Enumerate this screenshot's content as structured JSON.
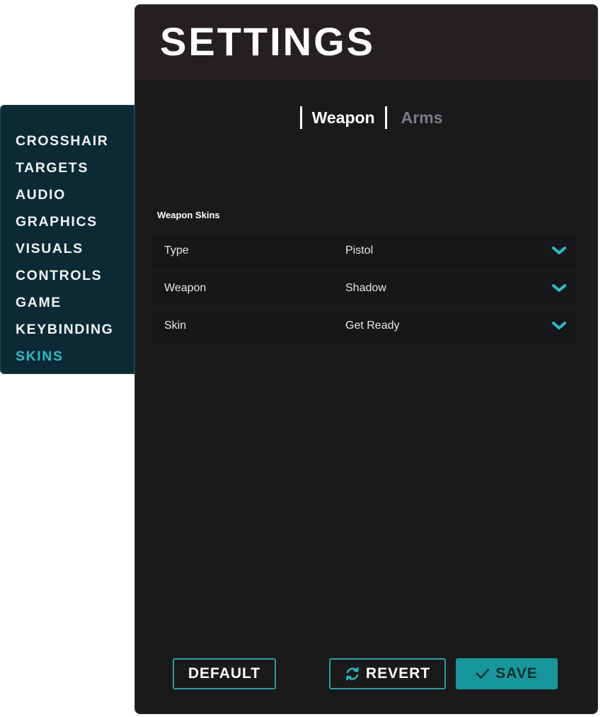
{
  "sidebar": {
    "items": [
      {
        "label": "CROSSHAIR",
        "active": false
      },
      {
        "label": "TARGETS",
        "active": false
      },
      {
        "label": "AUDIO",
        "active": false
      },
      {
        "label": "GRAPHICS",
        "active": false
      },
      {
        "label": "VISUALS",
        "active": false
      },
      {
        "label": "CONTROLS",
        "active": false
      },
      {
        "label": "GAME",
        "active": false
      },
      {
        "label": "KEYBINDING",
        "active": false
      },
      {
        "label": "SKINS",
        "active": true
      }
    ]
  },
  "header": {
    "title": "SETTINGS"
  },
  "tabs": [
    {
      "label": "Weapon",
      "active": true
    },
    {
      "label": "Arms",
      "active": false
    }
  ],
  "section": {
    "label": "Weapon Skins"
  },
  "rows": [
    {
      "label": "Type",
      "value": "Pistol",
      "icon": "chevron-down-icon"
    },
    {
      "label": "Weapon",
      "value": "Shadow",
      "icon": "chevron-down-icon"
    },
    {
      "label": "Skin",
      "value": "Get Ready",
      "icon": "chevron-down-icon"
    }
  ],
  "footer": {
    "default_label": "DEFAULT",
    "revert_label": "REVERT",
    "save_label": "SAVE",
    "revert_icon": "refresh-icon",
    "save_icon": "check-icon"
  },
  "colors": {
    "accent": "#2bbcc4",
    "save_button": "#17979b",
    "sidebar_bg": "#0b2a35",
    "panel_bg": "#1a1a1b",
    "header_bg": "#251f1f"
  }
}
